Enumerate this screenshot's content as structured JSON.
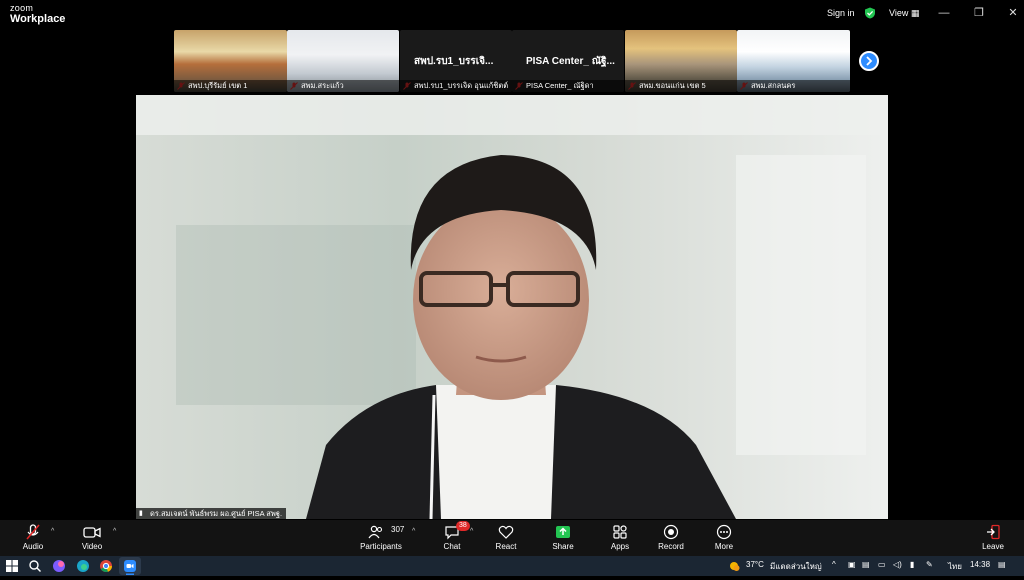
{
  "app": {
    "brand_top": "zoom",
    "brand_bottom": "Workplace",
    "sign_in": "Sign in",
    "view": "View"
  },
  "strip": {
    "tiles": [
      {
        "label": "สพป.บุรีรัมย์ เขต 1"
      },
      {
        "label": "สพม.สระแก้ว"
      },
      {
        "label": "สพป.รบ1_บรรเจิด อุนแก้ชิตต์",
        "title": "สพป.รบ1_บรรเจิ..."
      },
      {
        "label": "PISA Center_ ณัฐิดา",
        "title": "PISA Center_ ณัฐิ..."
      },
      {
        "label": "สพม.ขอนแก่น เขต 5"
      },
      {
        "label": "สพม.สกลนคร"
      }
    ]
  },
  "main": {
    "speaker_label": "ดร.สมเจตน์ พันธ์พรม ผอ.ศูนย์ PISA สพฐ."
  },
  "toolbar": {
    "audio": "Audio",
    "video": "Video",
    "participants": "Participants",
    "participants_count": "307",
    "chat": "Chat",
    "chat_badge": "38",
    "react": "React",
    "share": "Share",
    "apps": "Apps",
    "record": "Record",
    "more": "More",
    "leave": "Leave"
  },
  "taskbar": {
    "temp": "37°C",
    "weather": "มีแดดส่วนใหญ่",
    "lang": "ไทย",
    "time": "14:38"
  },
  "colors": {
    "accent": "#2d8cff",
    "share": "#23c552",
    "leave": "#e02828",
    "badge": "#e02828"
  }
}
